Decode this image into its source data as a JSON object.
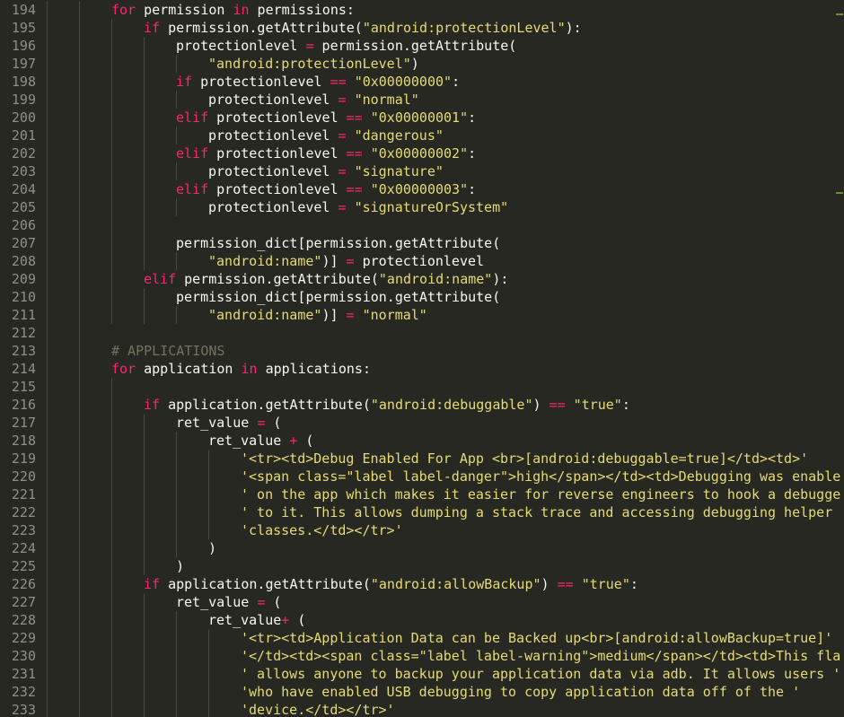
{
  "editor": {
    "theme_colors": {
      "background": "#272822",
      "text": "#f8f8f2",
      "keyword": "#f92672",
      "string": "#e6db74",
      "comment": "#75715e",
      "gutter_text": "#8f908a",
      "indent_guide": "#464741"
    },
    "lines": [
      {
        "num": "194",
        "indent": 2,
        "tokens": [
          [
            "kw",
            "for"
          ],
          [
            "p",
            " permission "
          ],
          [
            "kw",
            "in"
          ],
          [
            "p",
            " permissions:"
          ]
        ]
      },
      {
        "num": "195",
        "indent": 3,
        "tokens": [
          [
            "kw",
            "if"
          ],
          [
            "p",
            " permission.getAttribute("
          ],
          [
            "s",
            "\"android:protectionLevel\""
          ],
          [
            "p",
            "):"
          ]
        ]
      },
      {
        "num": "196",
        "indent": 4,
        "tokens": [
          [
            "p",
            "protectionlevel "
          ],
          [
            "kw",
            "="
          ],
          [
            "p",
            " permission.getAttribute("
          ]
        ]
      },
      {
        "num": "197",
        "indent": 5,
        "tokens": [
          [
            "s",
            "\"android:protectionLevel\""
          ],
          [
            "p",
            ")"
          ]
        ]
      },
      {
        "num": "198",
        "indent": 4,
        "tokens": [
          [
            "kw",
            "if"
          ],
          [
            "p",
            " protectionlevel "
          ],
          [
            "kw",
            "=="
          ],
          [
            "p",
            " "
          ],
          [
            "s",
            "\"0x00000000\""
          ],
          [
            "p",
            ":"
          ]
        ]
      },
      {
        "num": "199",
        "indent": 5,
        "tokens": [
          [
            "p",
            "protectionlevel "
          ],
          [
            "kw",
            "="
          ],
          [
            "p",
            " "
          ],
          [
            "s",
            "\"normal\""
          ]
        ]
      },
      {
        "num": "200",
        "indent": 4,
        "tokens": [
          [
            "kw",
            "elif"
          ],
          [
            "p",
            " protectionlevel "
          ],
          [
            "kw",
            "=="
          ],
          [
            "p",
            " "
          ],
          [
            "s",
            "\"0x00000001\""
          ],
          [
            "p",
            ":"
          ]
        ]
      },
      {
        "num": "201",
        "indent": 5,
        "tokens": [
          [
            "p",
            "protectionlevel "
          ],
          [
            "kw",
            "="
          ],
          [
            "p",
            " "
          ],
          [
            "s",
            "\"dangerous\""
          ]
        ]
      },
      {
        "num": "202",
        "indent": 4,
        "tokens": [
          [
            "kw",
            "elif"
          ],
          [
            "p",
            " protectionlevel "
          ],
          [
            "kw",
            "=="
          ],
          [
            "p",
            " "
          ],
          [
            "s",
            "\"0x00000002\""
          ],
          [
            "p",
            ":"
          ]
        ]
      },
      {
        "num": "203",
        "indent": 5,
        "tokens": [
          [
            "p",
            "protectionlevel "
          ],
          [
            "kw",
            "="
          ],
          [
            "p",
            " "
          ],
          [
            "s",
            "\"signature\""
          ]
        ]
      },
      {
        "num": "204",
        "indent": 4,
        "tokens": [
          [
            "kw",
            "elif"
          ],
          [
            "p",
            " protectionlevel "
          ],
          [
            "kw",
            "=="
          ],
          [
            "p",
            " "
          ],
          [
            "s",
            "\"0x00000003\""
          ],
          [
            "p",
            ":"
          ]
        ]
      },
      {
        "num": "205",
        "indent": 5,
        "tokens": [
          [
            "p",
            "protectionlevel "
          ],
          [
            "kw",
            "="
          ],
          [
            "p",
            " "
          ],
          [
            "s",
            "\"signatureOrSystem\""
          ]
        ]
      },
      {
        "num": "206",
        "indent": 4,
        "tokens": []
      },
      {
        "num": "207",
        "indent": 4,
        "tokens": [
          [
            "p",
            "permission_dict[permission.getAttribute("
          ]
        ]
      },
      {
        "num": "208",
        "indent": 5,
        "tokens": [
          [
            "s",
            "\"android:name\""
          ],
          [
            "p",
            ")] "
          ],
          [
            "kw",
            "="
          ],
          [
            "p",
            " protectionlevel"
          ]
        ]
      },
      {
        "num": "209",
        "indent": 3,
        "tokens": [
          [
            "kw",
            "elif"
          ],
          [
            "p",
            " permission.getAttribute("
          ],
          [
            "s",
            "\"android:name\""
          ],
          [
            "p",
            "):"
          ]
        ]
      },
      {
        "num": "210",
        "indent": 4,
        "tokens": [
          [
            "p",
            "permission_dict[permission.getAttribute("
          ]
        ]
      },
      {
        "num": "211",
        "indent": 5,
        "tokens": [
          [
            "s",
            "\"android:name\""
          ],
          [
            "p",
            ")] "
          ],
          [
            "kw",
            "="
          ],
          [
            "p",
            " "
          ],
          [
            "s",
            "\"normal\""
          ]
        ]
      },
      {
        "num": "212",
        "indent": 2,
        "tokens": []
      },
      {
        "num": "213",
        "indent": 2,
        "tokens": [
          [
            "c",
            "# APPLICATIONS"
          ]
        ]
      },
      {
        "num": "214",
        "indent": 2,
        "tokens": [
          [
            "kw",
            "for"
          ],
          [
            "p",
            " application "
          ],
          [
            "kw",
            "in"
          ],
          [
            "p",
            " applications:"
          ]
        ]
      },
      {
        "num": "215",
        "indent": 3,
        "tokens": []
      },
      {
        "num": "216",
        "indent": 3,
        "tokens": [
          [
            "kw",
            "if"
          ],
          [
            "p",
            " application.getAttribute("
          ],
          [
            "s",
            "\"android:debuggable\""
          ],
          [
            "p",
            ") "
          ],
          [
            "kw",
            "=="
          ],
          [
            "p",
            " "
          ],
          [
            "s",
            "\"true\""
          ],
          [
            "p",
            ":"
          ]
        ]
      },
      {
        "num": "217",
        "indent": 4,
        "tokens": [
          [
            "p",
            "ret_value "
          ],
          [
            "kw",
            "="
          ],
          [
            "p",
            " ("
          ]
        ]
      },
      {
        "num": "218",
        "indent": 5,
        "tokens": [
          [
            "p",
            "ret_value "
          ],
          [
            "kw",
            "+"
          ],
          [
            "p",
            " ("
          ]
        ]
      },
      {
        "num": "219",
        "indent": 6,
        "tokens": [
          [
            "s",
            "'<tr><td>Debug Enabled For App <br>[android:debuggable=true]</td><td>'"
          ]
        ]
      },
      {
        "num": "220",
        "indent": 6,
        "tokens": [
          [
            "s",
            "'<span class=\"label label-danger\">high</span></td><td>Debugging was enable"
          ]
        ]
      },
      {
        "num": "221",
        "indent": 6,
        "tokens": [
          [
            "s",
            "' on the app which makes it easier for reverse engineers to hook a debugge"
          ]
        ]
      },
      {
        "num": "222",
        "indent": 6,
        "tokens": [
          [
            "s",
            "' to it. This allows dumping a stack trace and accessing debugging helper"
          ]
        ]
      },
      {
        "num": "223",
        "indent": 6,
        "tokens": [
          [
            "s",
            "'classes.</td></tr>'"
          ]
        ]
      },
      {
        "num": "224",
        "indent": 5,
        "tokens": [
          [
            "p",
            ")"
          ]
        ]
      },
      {
        "num": "225",
        "indent": 4,
        "tokens": [
          [
            "p",
            ")"
          ]
        ]
      },
      {
        "num": "226",
        "indent": 3,
        "tokens": [
          [
            "kw",
            "if"
          ],
          [
            "p",
            " application.getAttribute("
          ],
          [
            "s",
            "\"android:allowBackup\""
          ],
          [
            "p",
            ") "
          ],
          [
            "kw",
            "=="
          ],
          [
            "p",
            " "
          ],
          [
            "s",
            "\"true\""
          ],
          [
            "p",
            ":"
          ]
        ]
      },
      {
        "num": "227",
        "indent": 4,
        "tokens": [
          [
            "p",
            "ret_value "
          ],
          [
            "kw",
            "="
          ],
          [
            "p",
            " ("
          ]
        ]
      },
      {
        "num": "228",
        "indent": 5,
        "tokens": [
          [
            "p",
            "ret_value"
          ],
          [
            "kw",
            "+"
          ],
          [
            "p",
            " ("
          ]
        ]
      },
      {
        "num": "229",
        "indent": 6,
        "tokens": [
          [
            "s",
            "'<tr><td>Application Data can be Backed up<br>[android:allowBackup=true]'"
          ]
        ]
      },
      {
        "num": "230",
        "indent": 6,
        "tokens": [
          [
            "s",
            "'</td><td><span class=\"label label-warning\">medium</span></td><td>This fla"
          ]
        ]
      },
      {
        "num": "231",
        "indent": 6,
        "tokens": [
          [
            "s",
            "' allows anyone to backup your application data via adb. It allows users '"
          ]
        ]
      },
      {
        "num": "232",
        "indent": 6,
        "tokens": [
          [
            "s",
            "'who have enabled USB debugging to copy application data off of the '"
          ]
        ]
      },
      {
        "num": "233",
        "indent": 6,
        "tokens": [
          [
            "s",
            "'device.</td></tr>'"
          ]
        ]
      }
    ]
  }
}
